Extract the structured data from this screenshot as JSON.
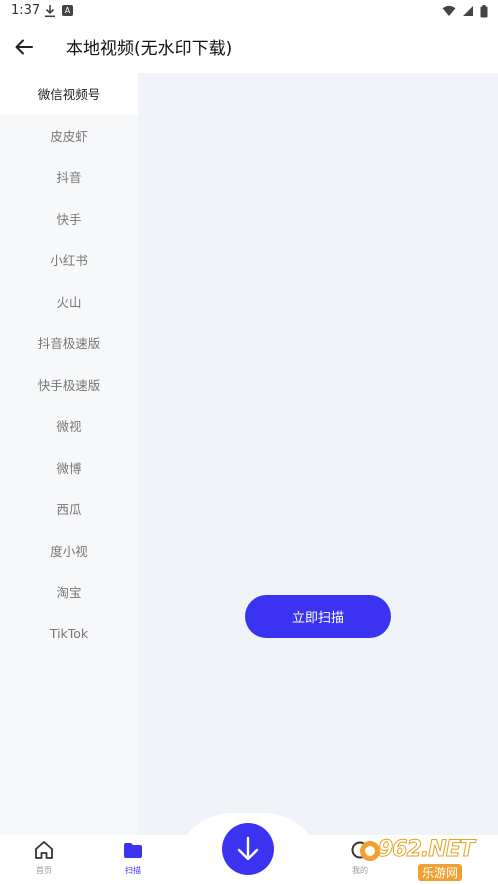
{
  "status_bar": {
    "time": "1:37",
    "a_icon_letter": "A"
  },
  "header": {
    "title": "本地视频(无水印下载)"
  },
  "sidebar": {
    "items": [
      {
        "label": "微信视频号",
        "active": true
      },
      {
        "label": "皮皮虾"
      },
      {
        "label": "抖音"
      },
      {
        "label": "快手"
      },
      {
        "label": "小红书"
      },
      {
        "label": "火山"
      },
      {
        "label": "抖音极速版"
      },
      {
        "label": "快手极速版"
      },
      {
        "label": "微视"
      },
      {
        "label": "微博"
      },
      {
        "label": "西瓜"
      },
      {
        "label": "度小视"
      },
      {
        "label": "淘宝"
      },
      {
        "label": "TikTok"
      }
    ]
  },
  "main": {
    "scan_button_label": "立即扫描"
  },
  "bottom_nav": {
    "home_label": "首页",
    "scan_label": "扫描",
    "my_label": "我的"
  },
  "watermark": {
    "text": "962.NET",
    "sub": "乐游网"
  },
  "colors": {
    "accent": "#3a33f0",
    "sidebar_bg": "#f7f8fa",
    "content_bg": "#f0f3f7"
  },
  "icons": {
    "back": "arrow-left-icon",
    "home": "home-icon",
    "scan": "folder-icon",
    "download": "arrow-down-icon",
    "my": "ring-icon",
    "wifi": "wifi-icon",
    "signal": "signal-icon",
    "battery": "battery-icon"
  }
}
